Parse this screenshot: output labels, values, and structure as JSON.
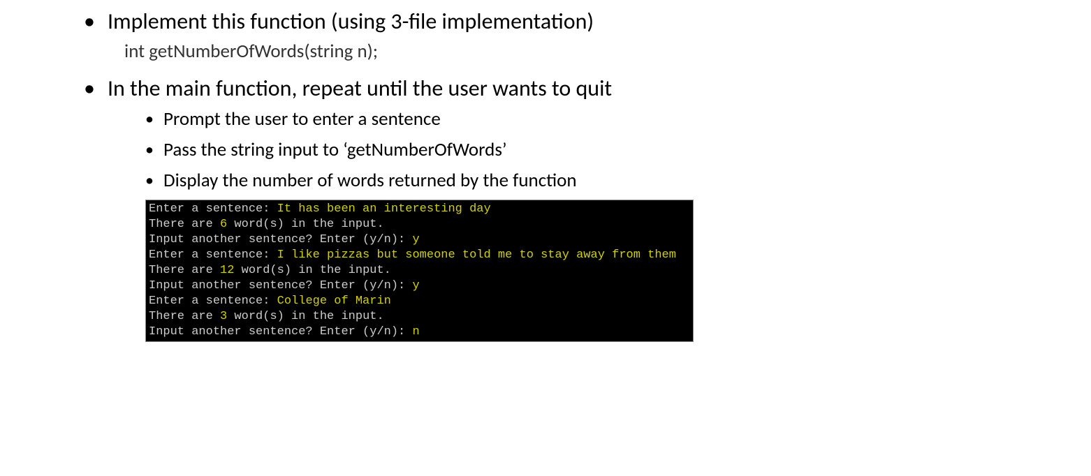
{
  "bullets": {
    "item1": "Implement this function (using 3-file implementation)",
    "item1_sub": "int getNumberOfWords(string n);",
    "item2": "In the main function, repeat until the user wants to quit",
    "item2_subs": {
      "a": "Prompt the user to enter a sentence",
      "b": "Pass the string input to ‘getNumberOfWords’",
      "c": "Display the number of words returned by the function"
    }
  },
  "terminal": {
    "lines": [
      {
        "prompt": "Enter a sentence: ",
        "input": "It has been an interesting day"
      },
      {
        "pre": "There are ",
        "num": "6",
        "post": " word(s) in the input."
      },
      {
        "prompt": "Input another sentence? Enter (y/n): ",
        "input": "y"
      },
      {
        "prompt": "Enter a sentence: ",
        "input": "I like pizzas but someone told me to stay away from them"
      },
      {
        "pre": "There are ",
        "num": "12",
        "post": " word(s) in the input."
      },
      {
        "prompt": "Input another sentence? Enter (y/n): ",
        "input": "y"
      },
      {
        "prompt": "Enter a sentence: ",
        "input": "College of Marin"
      },
      {
        "pre": "There are ",
        "num": "3",
        "post": " word(s) in the input."
      },
      {
        "prompt": "Input another sentence? Enter (y/n): ",
        "input": "n"
      }
    ]
  }
}
